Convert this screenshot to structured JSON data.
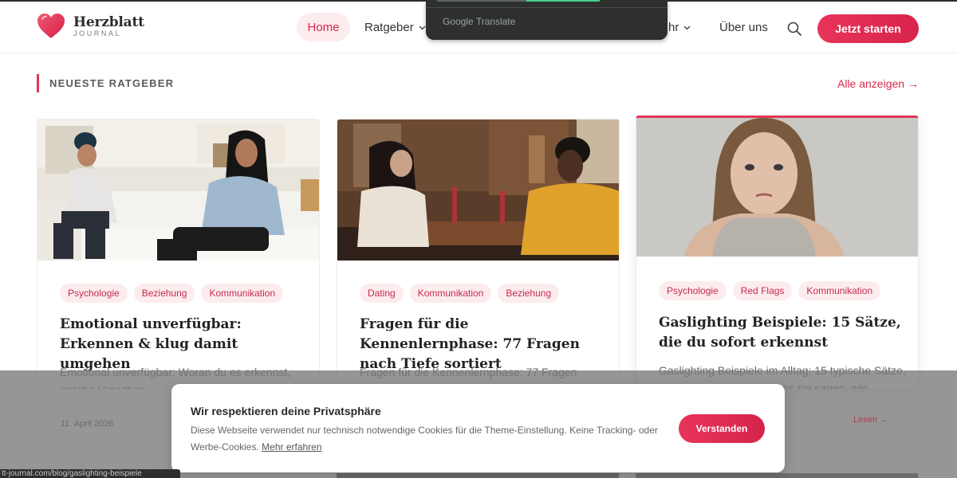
{
  "brand": {
    "name": "Herzblatt",
    "sub": "JOURNAL",
    "accent": "#e23657"
  },
  "nav": {
    "home": "Home",
    "ratgeber": "Ratgeber",
    "mehr": "hr",
    "ueber": "Über uns",
    "cta": "Jetzt starten"
  },
  "translate_popup": {
    "label": "Google Translate"
  },
  "section": {
    "title": "NEUESTE RATGEBER",
    "all": "Alle anzeigen →"
  },
  "cards": [
    {
      "tags": [
        "Psychologie",
        "Beziehung",
        "Kommunikation"
      ],
      "title": "Emotional unverfügbar: Erkennen & klug damit umgehen",
      "excerpt": "Emotional unverfügbar: Woran du es erkennst, welche Ursachen"
    },
    {
      "tags": [
        "Dating",
        "Kommunikation",
        "Beziehung"
      ],
      "title": "Fragen für die Kennenlernphase: 77 Fragen nach Tiefe sortiert",
      "excerpt": "Fragen für die Kennenlernphase: 77 Fragen"
    },
    {
      "tags": [
        "Psychologie",
        "Red Flags",
        "Kommunikation"
      ],
      "title": "Gaslighting Beispiele: 15 Sätze, die du sofort erkennst",
      "excerpt": "Gaslighting Beispiele im Alltag: 15 typische Sätze, woran du sie erkennst, was sie sagen, wie"
    }
  ],
  "behind_overlay": {
    "date": "11. April 2026",
    "read_more": "Lesen →"
  },
  "cookie": {
    "title": "Wir respektieren deine Privatsphäre",
    "text": "Diese Webseite verwendet nur technisch notwendige Cookies für die Theme-Einstellung. Keine Tracking- oder Werbe-Cookies.",
    "link": "Mehr erfahren",
    "button": "Verstanden"
  },
  "status_url": "tt-journal.com/blog/gaslighting-beispiele"
}
